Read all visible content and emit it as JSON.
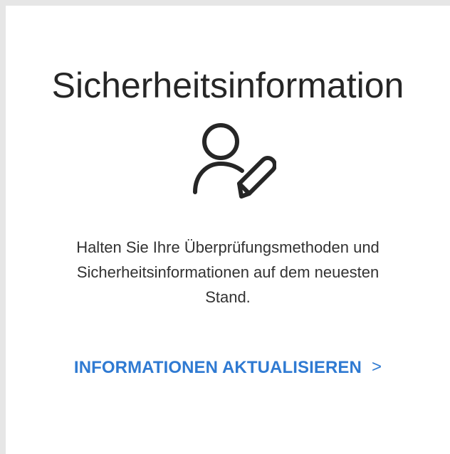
{
  "card": {
    "title": "Sicherheitsinformation",
    "icon": "user-edit-icon",
    "description_lines": [
      "Halten Sie Ihre Überprüfungsmethoden und",
      "Sicherheitsinformationen auf dem neuesten",
      "Stand."
    ],
    "action_label": "INFORMATIONEN AKTUALISIEREN",
    "action_chevron": ">"
  },
  "colors": {
    "page_background": "#e6e6e6",
    "card_background": "#ffffff",
    "title_text": "#262626",
    "body_text": "#323232",
    "accent": "#2f7ad2"
  }
}
